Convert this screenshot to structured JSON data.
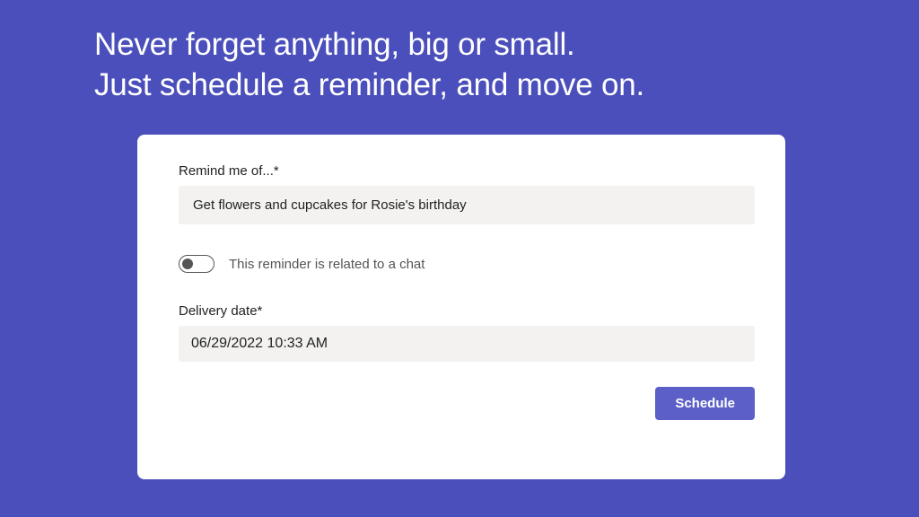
{
  "hero": {
    "line1": "Never forget anything, big or small.",
    "line2": "Just schedule a reminder, and move on."
  },
  "form": {
    "remind_label": "Remind me of...*",
    "remind_value": "Get flowers and cupcakes for Rosie's birthday",
    "toggle_label": "This reminder is related to a chat",
    "toggle_on": false,
    "delivery_label": "Delivery date*",
    "delivery_value": "06/29/2022 10:33 AM",
    "schedule_button": "Schedule"
  },
  "colors": {
    "background": "#4b4fbb",
    "button": "#5b5fc7",
    "input_bg": "#f3f2f1"
  }
}
